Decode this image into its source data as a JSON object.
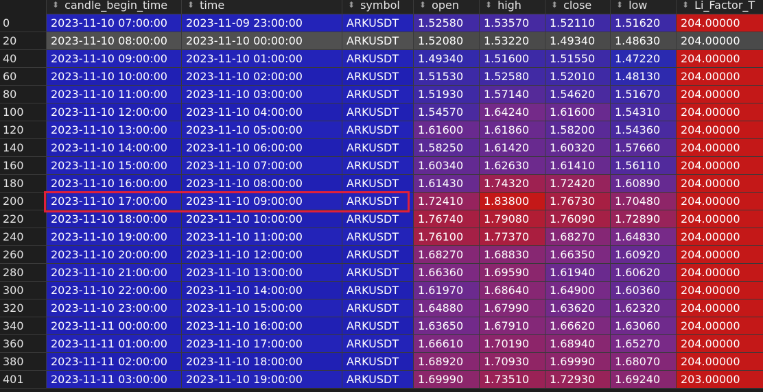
{
  "table": {
    "columns": [
      {
        "key": "index",
        "label": ""
      },
      {
        "key": "candle_begin_time",
        "label": "candle_begin_time"
      },
      {
        "key": "time",
        "label": "time"
      },
      {
        "key": "symbol",
        "label": "symbol"
      },
      {
        "key": "open",
        "label": "open"
      },
      {
        "key": "high",
        "label": "high"
      },
      {
        "key": "close",
        "label": "close"
      },
      {
        "key": "low",
        "label": "low"
      },
      {
        "key": "li_factor",
        "label": "Li_Factor_T"
      }
    ],
    "sort_glyph": "⬍",
    "highlighted_row_index": "200",
    "colors": {
      "blue_cells": "#2020b4",
      "gradient_low": "#2a2ab0",
      "gradient_mid": "#7a2a86",
      "gradient_high": "#c41818",
      "highlight_border": "#e0203a",
      "gray_row": "#4a4a4a"
    },
    "rows": [
      {
        "index": "0",
        "candle_begin_time": "2023-11-10 07:00:00",
        "time": "2023-11-09 23:00:00",
        "symbol": "ARKUSDT",
        "open": "1.52580",
        "high": "1.53570",
        "close": "1.52110",
        "low": "1.51620",
        "li_factor": "204.00000"
      },
      {
        "index": "20",
        "candle_begin_time": "2023-11-10 08:00:00",
        "time": "2023-11-10 00:00:00",
        "symbol": "ARKUSDT",
        "open": "1.52080",
        "high": "1.53220",
        "close": "1.49340",
        "low": "1.48630",
        "li_factor": "204.00000"
      },
      {
        "index": "40",
        "candle_begin_time": "2023-11-10 09:00:00",
        "time": "2023-11-10 01:00:00",
        "symbol": "ARKUSDT",
        "open": "1.49340",
        "high": "1.51600",
        "close": "1.51550",
        "low": "1.47220",
        "li_factor": "204.00000"
      },
      {
        "index": "60",
        "candle_begin_time": "2023-11-10 10:00:00",
        "time": "2023-11-10 02:00:00",
        "symbol": "ARKUSDT",
        "open": "1.51530",
        "high": "1.52580",
        "close": "1.52010",
        "low": "1.48130",
        "li_factor": "204.00000"
      },
      {
        "index": "80",
        "candle_begin_time": "2023-11-10 11:00:00",
        "time": "2023-11-10 03:00:00",
        "symbol": "ARKUSDT",
        "open": "1.51930",
        "high": "1.57140",
        "close": "1.54620",
        "low": "1.51670",
        "li_factor": "204.00000"
      },
      {
        "index": "100",
        "candle_begin_time": "2023-11-10 12:00:00",
        "time": "2023-11-10 04:00:00",
        "symbol": "ARKUSDT",
        "open": "1.54570",
        "high": "1.64240",
        "close": "1.61600",
        "low": "1.54310",
        "li_factor": "204.00000"
      },
      {
        "index": "120",
        "candle_begin_time": "2023-11-10 13:00:00",
        "time": "2023-11-10 05:00:00",
        "symbol": "ARKUSDT",
        "open": "1.61600",
        "high": "1.61860",
        "close": "1.58200",
        "low": "1.54360",
        "li_factor": "204.00000"
      },
      {
        "index": "140",
        "candle_begin_time": "2023-11-10 14:00:00",
        "time": "2023-11-10 06:00:00",
        "symbol": "ARKUSDT",
        "open": "1.58250",
        "high": "1.61420",
        "close": "1.60320",
        "low": "1.57660",
        "li_factor": "204.00000"
      },
      {
        "index": "160",
        "candle_begin_time": "2023-11-10 15:00:00",
        "time": "2023-11-10 07:00:00",
        "symbol": "ARKUSDT",
        "open": "1.60340",
        "high": "1.62630",
        "close": "1.61410",
        "low": "1.56110",
        "li_factor": "204.00000"
      },
      {
        "index": "180",
        "candle_begin_time": "2023-11-10 16:00:00",
        "time": "2023-11-10 08:00:00",
        "symbol": "ARKUSDT",
        "open": "1.61430",
        "high": "1.74320",
        "close": "1.72420",
        "low": "1.60890",
        "li_factor": "204.00000"
      },
      {
        "index": "200",
        "candle_begin_time": "2023-11-10 17:00:00",
        "time": "2023-11-10 09:00:00",
        "symbol": "ARKUSDT",
        "open": "1.72410",
        "high": "1.83800",
        "close": "1.76730",
        "low": "1.70480",
        "li_factor": "204.00000"
      },
      {
        "index": "220",
        "candle_begin_time": "2023-11-10 18:00:00",
        "time": "2023-11-10 10:00:00",
        "symbol": "ARKUSDT",
        "open": "1.76740",
        "high": "1.79080",
        "close": "1.76090",
        "low": "1.72890",
        "li_factor": "204.00000"
      },
      {
        "index": "240",
        "candle_begin_time": "2023-11-10 19:00:00",
        "time": "2023-11-10 11:00:00",
        "symbol": "ARKUSDT",
        "open": "1.76100",
        "high": "1.77370",
        "close": "1.68270",
        "low": "1.64830",
        "li_factor": "204.00000"
      },
      {
        "index": "260",
        "candle_begin_time": "2023-11-10 20:00:00",
        "time": "2023-11-10 12:00:00",
        "symbol": "ARKUSDT",
        "open": "1.68270",
        "high": "1.68830",
        "close": "1.66350",
        "low": "1.60920",
        "li_factor": "204.00000"
      },
      {
        "index": "280",
        "candle_begin_time": "2023-11-10 21:00:00",
        "time": "2023-11-10 13:00:00",
        "symbol": "ARKUSDT",
        "open": "1.66360",
        "high": "1.69590",
        "close": "1.61940",
        "low": "1.60620",
        "li_factor": "204.00000"
      },
      {
        "index": "300",
        "candle_begin_time": "2023-11-10 22:00:00",
        "time": "2023-11-10 14:00:00",
        "symbol": "ARKUSDT",
        "open": "1.61970",
        "high": "1.68640",
        "close": "1.64900",
        "low": "1.60360",
        "li_factor": "204.00000"
      },
      {
        "index": "320",
        "candle_begin_time": "2023-11-10 23:00:00",
        "time": "2023-11-10 15:00:00",
        "symbol": "ARKUSDT",
        "open": "1.64880",
        "high": "1.67990",
        "close": "1.63620",
        "low": "1.62320",
        "li_factor": "204.00000"
      },
      {
        "index": "340",
        "candle_begin_time": "2023-11-11 00:00:00",
        "time": "2023-11-10 16:00:00",
        "symbol": "ARKUSDT",
        "open": "1.63650",
        "high": "1.67910",
        "close": "1.66620",
        "low": "1.63060",
        "li_factor": "204.00000"
      },
      {
        "index": "360",
        "candle_begin_time": "2023-11-11 01:00:00",
        "time": "2023-11-10 17:00:00",
        "symbol": "ARKUSDT",
        "open": "1.66610",
        "high": "1.70190",
        "close": "1.68940",
        "low": "1.65270",
        "li_factor": "204.00000"
      },
      {
        "index": "380",
        "candle_begin_time": "2023-11-11 02:00:00",
        "time": "2023-11-10 18:00:00",
        "symbol": "ARKUSDT",
        "open": "1.68920",
        "high": "1.70930",
        "close": "1.69990",
        "low": "1.68070",
        "li_factor": "204.00000"
      },
      {
        "index": "401",
        "candle_begin_time": "2023-11-11 03:00:00",
        "time": "2023-11-10 19:00:00",
        "symbol": "ARKUSDT",
        "open": "1.69990",
        "high": "1.73510",
        "close": "1.72930",
        "low": "1.69240",
        "li_factor": "203.00000"
      }
    ]
  }
}
